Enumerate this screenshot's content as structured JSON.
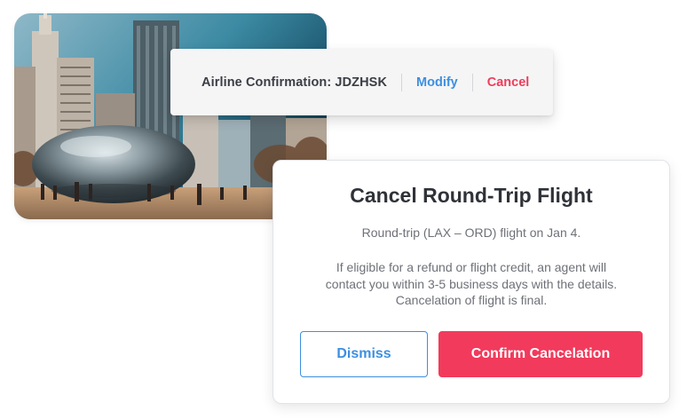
{
  "photo": {
    "alt_icon": "chicago-bean-photo"
  },
  "confirmation_bar": {
    "label": "Airline Confirmation: JDZHSK",
    "modify_label": "Modify",
    "cancel_label": "Cancel"
  },
  "dialog": {
    "title": "Cancel Round-Trip Flight",
    "route_text": "Round-trip (LAX – ORD) flight on Jan 4.",
    "body_lines": [
      "If eligible for a refund or flight credit, an agent will",
      "contact you within 3-5 business days with the details.",
      "Cancelation of flight is final."
    ],
    "dismiss_label": "Dismiss",
    "confirm_label": "Confirm Cancelation"
  },
  "colors": {
    "accent_blue": "#3d8fe0",
    "danger_red": "#f23a5c",
    "title_text": "#2f3238",
    "body_text": "#6e7178"
  }
}
